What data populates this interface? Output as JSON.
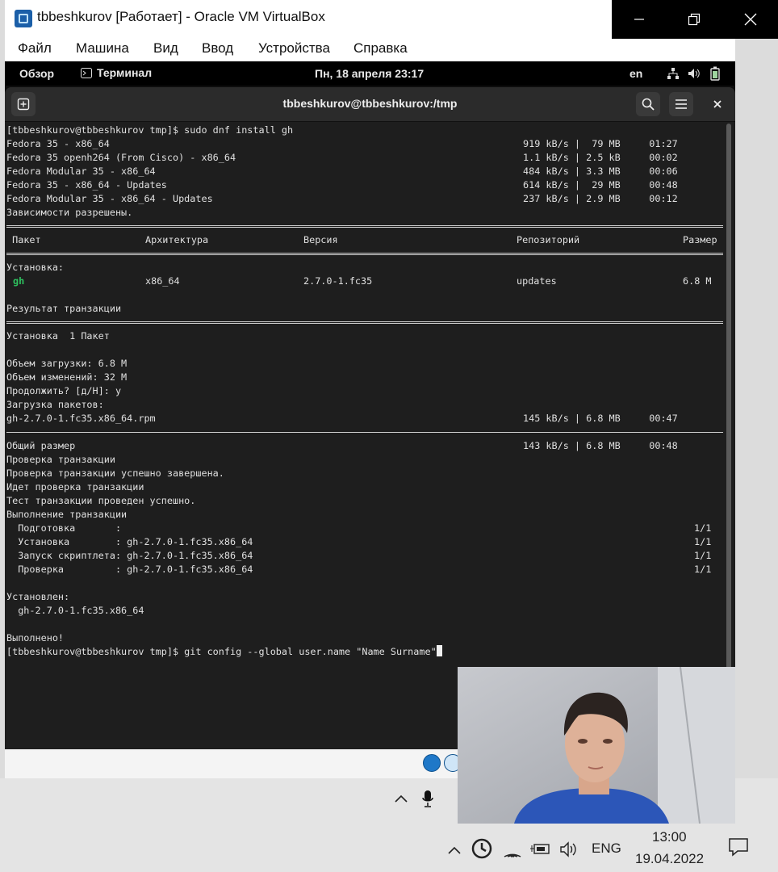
{
  "window": {
    "title": "tbbeshkurov [Работает] - Oracle VM VirtualBox",
    "icon": "virtualbox-icon"
  },
  "menu": [
    "Файл",
    "Машина",
    "Вид",
    "Ввод",
    "Устройства",
    "Справка"
  ],
  "gnome": {
    "overview": "Обзор",
    "app": "Терминал",
    "clock": "Пн, 18 апреля  23:17",
    "lang": "en"
  },
  "terminal": {
    "title": "tbbeshkurov@tbbeshkurov:/tmp",
    "cursor_after_last_line": true
  },
  "taskbar": {
    "lang": "ENG",
    "time": "13:00",
    "date": "19.04.2022"
  },
  "colors": {
    "term_bg": "#1e1e1e",
    "term_fg": "#e0e0e0",
    "green": "#2ec25f"
  },
  "lines": [
    {
      "t": "cmd",
      "a": "[tbbeshkurov@tbbeshkurov tmp]$ sudo dnf install gh"
    },
    {
      "t": "dl",
      "a": "Fedora 35 - x86_64",
      "b": "919 kB/s |  79 MB     01:27"
    },
    {
      "t": "dl",
      "a": "Fedora 35 openh264 (From Cisco) - x86_64",
      "b": "1.1 kB/s | 2.5 kB     00:02"
    },
    {
      "t": "dl",
      "a": "Fedora Modular 35 - x86_64",
      "b": "484 kB/s | 3.3 MB     00:06"
    },
    {
      "t": "dl",
      "a": "Fedora 35 - x86_64 - Updates",
      "b": "614 kB/s |  29 MB     00:48"
    },
    {
      "t": "dl",
      "a": "Fedora Modular 35 - x86_64 - Updates",
      "b": "237 kB/s | 2.9 MB     00:12"
    },
    {
      "t": "txt",
      "a": "Зависимости разрешены."
    },
    {
      "t": "sep2"
    },
    {
      "t": "hdr",
      "c1": " Пакет",
      "c2": "Архитектура",
      "c3": "Версия",
      "c4": "Репозиторий",
      "c5": "Размер"
    },
    {
      "t": "sep2"
    },
    {
      "t": "txt",
      "a": "Установка:"
    },
    {
      "t": "pkg",
      "c1": "gh",
      "c2": "x86_64",
      "c3": "2.7.0-1.fc35",
      "c4": "updates",
      "c5": "6.8 М"
    },
    {
      "t": "blank"
    },
    {
      "t": "txt",
      "a": "Результат транзакции"
    },
    {
      "t": "sep2"
    },
    {
      "t": "txt",
      "a": "Установка  1 Пакет"
    },
    {
      "t": "blank"
    },
    {
      "t": "txt",
      "a": "Объем загрузки: 6.8 М"
    },
    {
      "t": "txt",
      "a": "Объем изменений: 32 М"
    },
    {
      "t": "txt",
      "a": "Продолжить? [д/Н]: y"
    },
    {
      "t": "txt",
      "a": "Загрузка пакетов:"
    },
    {
      "t": "dl",
      "a": "gh-2.7.0-1.fc35.x86_64.rpm",
      "b": "145 kB/s | 6.8 MB     00:47"
    },
    {
      "t": "sep"
    },
    {
      "t": "dl",
      "a": "Общий размер",
      "b": "143 kB/s | 6.8 MB     00:48"
    },
    {
      "t": "txt",
      "a": "Проверка транзакции"
    },
    {
      "t": "txt",
      "a": "Проверка транзакции успешно завершена."
    },
    {
      "t": "txt",
      "a": "Идет проверка транзакции"
    },
    {
      "t": "txt",
      "a": "Тест транзакции проведен успешно."
    },
    {
      "t": "txt",
      "a": "Выполнение транзакции"
    },
    {
      "t": "step",
      "a": "  Подготовка       :",
      "b": "1/1"
    },
    {
      "t": "step",
      "a": "  Установка        : gh-2.7.0-1.fc35.x86_64",
      "b": "1/1"
    },
    {
      "t": "step",
      "a": "  Запуск скриптлета: gh-2.7.0-1.fc35.x86_64",
      "b": "1/1"
    },
    {
      "t": "step",
      "a": "  Проверка         : gh-2.7.0-1.fc35.x86_64",
      "b": "1/1"
    },
    {
      "t": "blank"
    },
    {
      "t": "txt",
      "a": "Установлен:"
    },
    {
      "t": "txt",
      "a": "  gh-2.7.0-1.fc35.x86_64"
    },
    {
      "t": "blank"
    },
    {
      "t": "txt",
      "a": "Выполнено!"
    },
    {
      "t": "cmd",
      "a": "[tbbeshkurov@tbbeshkurov tmp]$ git config --global user.name \"Name Surname\""
    }
  ]
}
